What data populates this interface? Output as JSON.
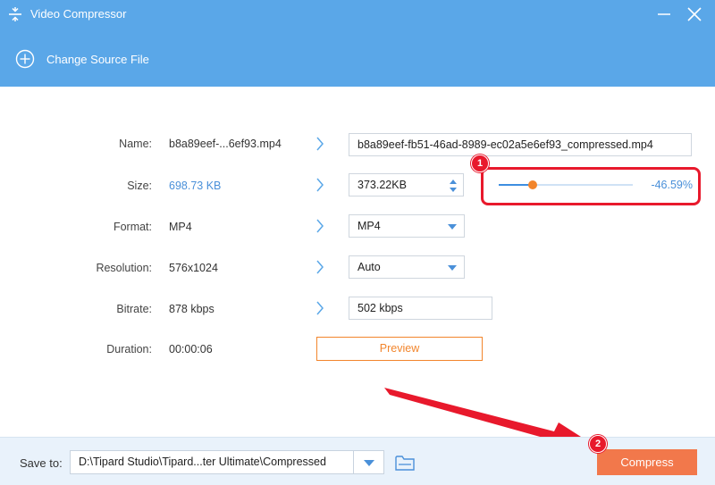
{
  "window": {
    "title": "Video Compressor",
    "icon": "compress-icon"
  },
  "toolbar": {
    "change_source_label": "Change Source File",
    "icon": "plus-circle-icon"
  },
  "rows": {
    "name": {
      "label": "Name:",
      "source": "b8a89eef-...6ef93.mp4",
      "output": "b8a89eef-fb51-46ad-8989-ec02a5e6ef93_compressed.mp4"
    },
    "size": {
      "label": "Size:",
      "source": "698.73 KB",
      "output": "373.22KB",
      "percent_text": "-46.59%",
      "slider_fraction": 0.25
    },
    "format": {
      "label": "Format:",
      "source": "MP4",
      "output": "MP4"
    },
    "resolution": {
      "label": "Resolution:",
      "source": "576x1024",
      "output": "Auto"
    },
    "bitrate": {
      "label": "Bitrate:",
      "source": "878 kbps",
      "output": "502 kbps"
    },
    "duration": {
      "label": "Duration:",
      "source": "00:00:06"
    }
  },
  "preview_label": "Preview",
  "footer": {
    "save_label": "Save to:",
    "path": "D:\\Tipard Studio\\Tipard...ter Ultimate\\Compressed",
    "compress_label": "Compress"
  },
  "annotations": {
    "badge_1": "1",
    "badge_2": "2"
  },
  "colors": {
    "accent_blue": "#5aa7e8",
    "orange": "#f2852c",
    "compress": "#f2784b",
    "highlight_red": "#e8192c"
  }
}
